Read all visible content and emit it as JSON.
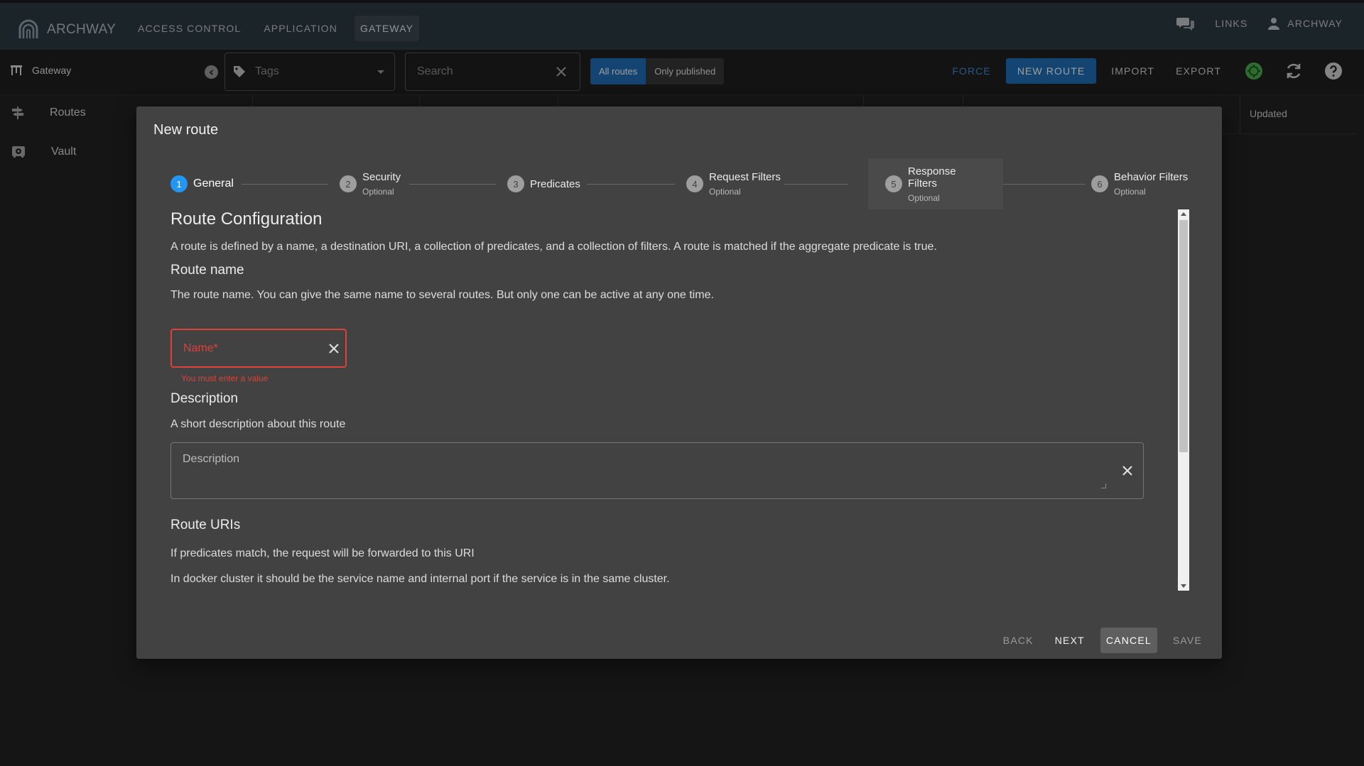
{
  "brand": {
    "name": "ARCHWAY"
  },
  "top_nav": [
    "ACCESS CONTROL",
    "APPLICATION",
    "GATEWAY"
  ],
  "top_right": {
    "links": "LINKS",
    "user": "ARCHWAY"
  },
  "toolbar": {
    "section": "Gateway",
    "tags_placeholder": "Tags",
    "search_placeholder": "Search",
    "filter_options": [
      "All routes",
      "Only published"
    ],
    "force": "FORCE",
    "new_route": "NEW ROUTE",
    "import": "IMPORT",
    "export": "EXPORT",
    "status_color": "#4caf50"
  },
  "sidenav": [
    "Routes",
    "Vault"
  ],
  "table": {
    "updated_header": "Updated"
  },
  "dialog": {
    "title": "New route",
    "steps": [
      {
        "num": "1",
        "label": "General",
        "optional": ""
      },
      {
        "num": "2",
        "label": "Security",
        "optional": "Optional"
      },
      {
        "num": "3",
        "label": "Predicates",
        "optional": ""
      },
      {
        "num": "4",
        "label": "Request Filters",
        "optional": "Optional"
      },
      {
        "num": "5",
        "label": "Response Filters",
        "optional": "Optional"
      },
      {
        "num": "6",
        "label": "Behavior Filters",
        "optional": "Optional"
      }
    ],
    "content": {
      "heading": "Route Configuration",
      "intro": "A route is defined by a name, a destination URI, a collection of predicates, and a collection of filters. A route is matched if the aggregate predicate is true.",
      "route_name_heading": "Route name",
      "route_name_desc": "The route name. You can give the same name to several routes. But only one can be active at any one time.",
      "name_placeholder": "Name*",
      "name_error": "You must enter a value",
      "description_heading": "Description",
      "description_desc": "A short description about this route",
      "description_placeholder": "Description",
      "uris_heading": "Route URIs",
      "uris_desc1": "If predicates match, the request will be forwarded to this URI",
      "uris_desc2": "In docker cluster it should be the service name and internal port if the service is in the same cluster."
    },
    "actions": {
      "back": "BACK",
      "next": "NEXT",
      "cancel": "CANCEL",
      "save": "SAVE"
    }
  }
}
